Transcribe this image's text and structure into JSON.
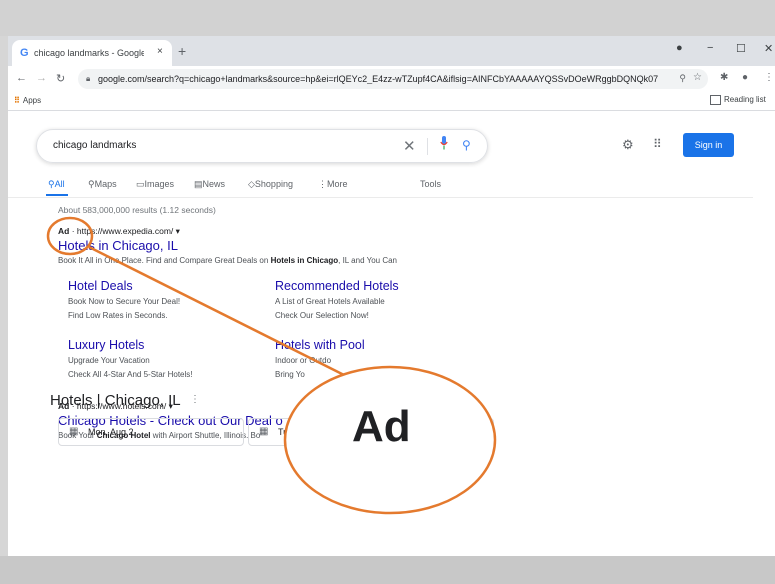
{
  "browser": {
    "tab_title": "chicago landmarks - Google Sea",
    "tab_close": "×",
    "new_tab": "+",
    "url": "google.com/search?q=chicago+landmarks&source=hp&ei=rlQEYc2_E4zz-wTZupf4CA&iflsig=AINFCbYAAAAAYQSSvDOeWRggbDQNQk07_...",
    "bookmarks": {
      "apps": "Apps",
      "reading_list": "Reading list"
    }
  },
  "search": {
    "query": "chicago landmarks",
    "sign_in": "Sign in",
    "tabs": [
      "All",
      "Maps",
      "Images",
      "News",
      "Shopping",
      "More"
    ],
    "tools": "Tools",
    "result_stats": "About 583,000,000 results (1.12 seconds)"
  },
  "ad1": {
    "label": "Ad",
    "url": "https://www.expedia.com/",
    "title": "Hotels in Chicago, IL",
    "desc_pre": "Book It All in One Place. Find and Compare Great Deals on ",
    "desc_bold": "Hotels in Chicago",
    "desc_post": ", IL and You Can",
    "sitelinks": [
      {
        "title": "Hotel Deals",
        "line1": "Book Now to Secure Your Deal!",
        "line2": "Find Low Rates in Seconds."
      },
      {
        "title": "Recommended Hotels",
        "line1": "A List of Great Hotels Available",
        "line2": "Check Our Selection Now!"
      },
      {
        "title": "Luxury Hotels",
        "line1": "Upgrade Your Vacation",
        "line2": "Check All 4-Star And 5-Star Hotels!"
      },
      {
        "title": "Hotels with Pool",
        "line1": "Indoor or Outdo",
        "line2": "Bring Yo"
      }
    ]
  },
  "ad2": {
    "label": "Ad",
    "url": "https://www.hotels.com/",
    "title": "Chicago Hotels - Check out Our Deal o",
    "desc_pre": "Book Your ",
    "desc_bold": "Chicago Hotel",
    "desc_post": " with Airport Shuttle, Illinois. Bo"
  },
  "hotels": {
    "heading": "Hotels | Chicago, IL",
    "check_in": "Mon, Aug 2",
    "check_out": "Tue, Aug 3",
    "guests": "2"
  },
  "callout": {
    "text": "Ad",
    "color": "#e47a2e"
  }
}
